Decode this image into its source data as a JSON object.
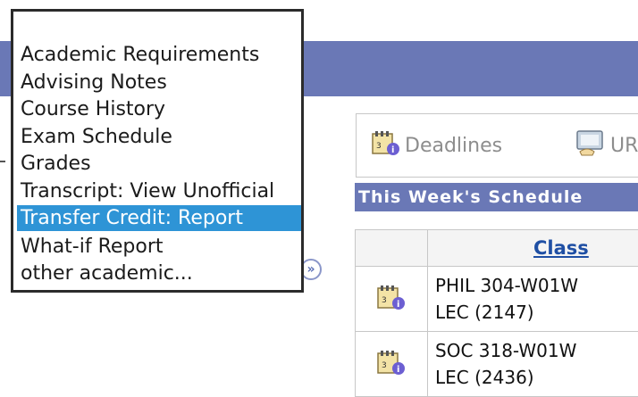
{
  "dropdown": {
    "items": [
      {
        "label": "Academic Requirements",
        "selected": false
      },
      {
        "label": "Advising Notes",
        "selected": false
      },
      {
        "label": "Course History",
        "selected": false
      },
      {
        "label": "Exam Schedule",
        "selected": false
      },
      {
        "label": "Grades",
        "selected": false
      },
      {
        "label": "Transcript: View Unofficial",
        "selected": false
      },
      {
        "label": "Transfer Credit: Report",
        "selected": true
      },
      {
        "label": "What-if Report",
        "selected": false
      },
      {
        "label": "other academic...",
        "selected": false
      }
    ]
  },
  "links": {
    "deadlines": "Deadlines",
    "url": "UR"
  },
  "schedule": {
    "title": "This Week's Schedule",
    "column_class": "Class",
    "rows": [
      {
        "line1": "PHIL 304-W01W",
        "line2": "LEC (2147)"
      },
      {
        "line1": "SOC 318-W01W",
        "line2": "LEC (2436)"
      }
    ]
  },
  "colors": {
    "banner": "#6a78b6",
    "selected": "#2e94d6",
    "link": "#1f4fa4"
  },
  "icons": {
    "expand": "chevron-double-right-icon",
    "row": "calendar-info-icon"
  }
}
